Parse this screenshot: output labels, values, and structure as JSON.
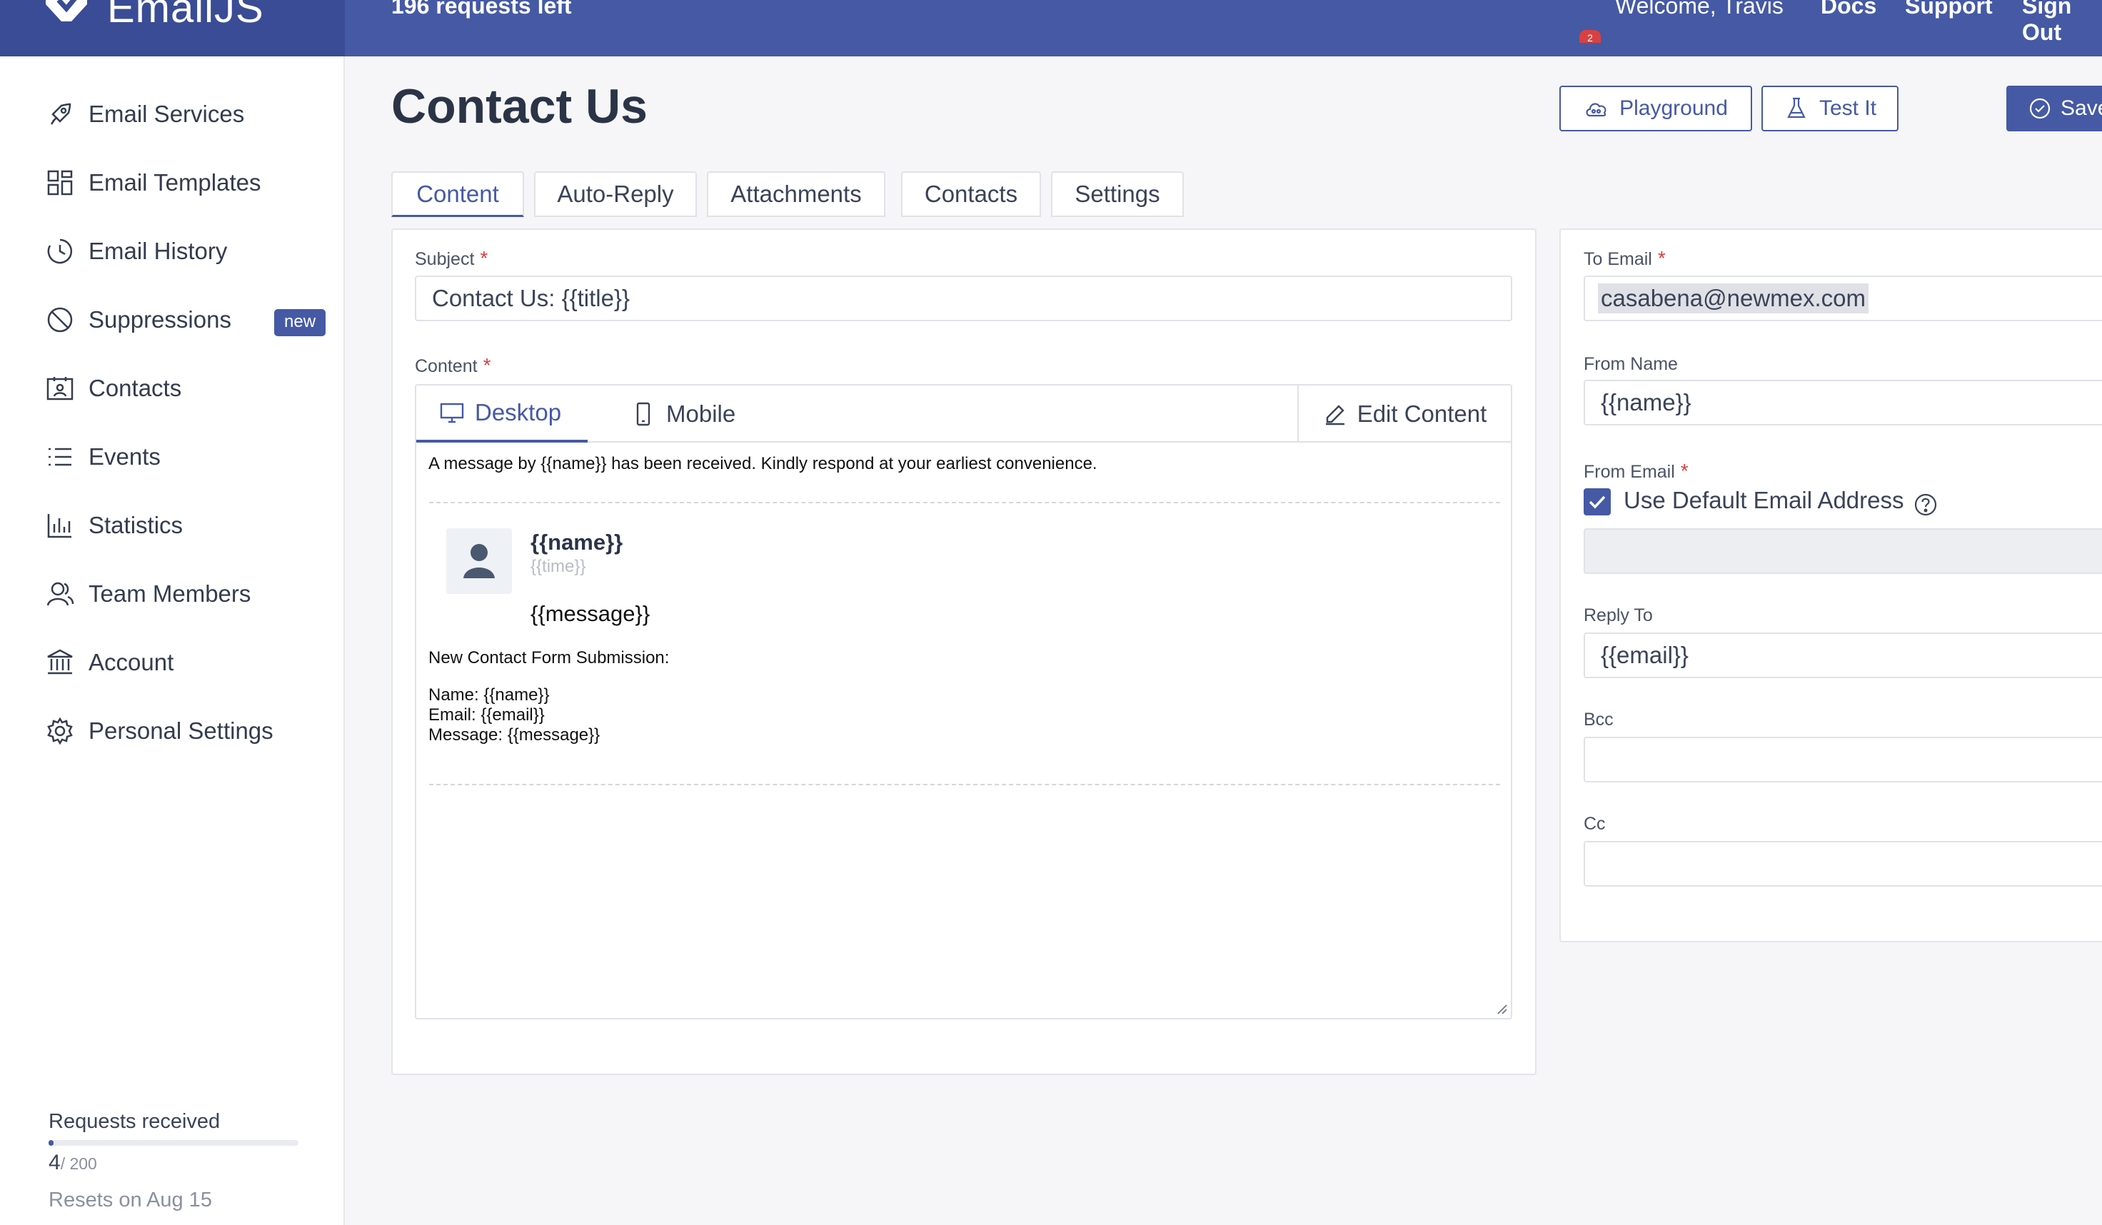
{
  "topbar": {
    "logo_text": "EmailJS",
    "requests_left": "196 requests left",
    "welcome": "Welcome, Travis",
    "notification_count": "2",
    "links": [
      "Docs",
      "Support",
      "Sign Out"
    ]
  },
  "sidebar": {
    "items": [
      {
        "label": "Email Services",
        "icon": "rocket-icon"
      },
      {
        "label": "Email Templates",
        "icon": "grid-icon"
      },
      {
        "label": "Email History",
        "icon": "clock-history-icon"
      },
      {
        "label": "Suppressions",
        "icon": "ban-icon",
        "badge": "new"
      },
      {
        "label": "Contacts",
        "icon": "contact-card-icon"
      },
      {
        "label": "Events",
        "icon": "list-icon"
      },
      {
        "label": "Statistics",
        "icon": "bar-chart-icon"
      },
      {
        "label": "Team Members",
        "icon": "team-icon"
      },
      {
        "label": "Account",
        "icon": "bank-icon"
      },
      {
        "label": "Personal Settings",
        "icon": "gear-icon"
      }
    ],
    "usage": {
      "title": "Requests received",
      "count": "4",
      "total": "/ 200",
      "fraction": 0.02,
      "reset": "Resets on Aug 15"
    }
  },
  "page": {
    "title": "Contact Us",
    "buttons": {
      "playground": "Playground",
      "test_it": "Test It",
      "save": "Save"
    },
    "tabs": [
      "Content",
      "Auto-Reply",
      "Attachments",
      "Contacts",
      "Settings"
    ]
  },
  "content": {
    "subject_label": "Subject",
    "subject_value": "Contact Us: {{title}}",
    "content_label": "Content",
    "editor_tabs": {
      "desktop": "Desktop",
      "mobile": "Mobile",
      "edit": "Edit Content"
    },
    "email_body": {
      "intro": "A message by {{name}} has been received. Kindly respond at your earliest convenience.",
      "card_name": "{{name}}",
      "card_time": "{{time}}",
      "card_message": "{{message}}",
      "submission_title": "New Contact Form Submission:",
      "line_name": "Name: {{name}}",
      "line_email": "Email: {{email}}",
      "line_message": "Message: {{message}}"
    }
  },
  "settings_panel": {
    "to_email_label": "To Email",
    "to_email_value": "casabena@newmex.com",
    "from_name_label": "From Name",
    "from_name_value": "{{name}}",
    "from_email_label": "From Email",
    "use_default_label": "Use Default Email Address",
    "use_default_checked": true,
    "reply_to_label": "Reply To",
    "reply_to_value": "{{email}}",
    "bcc_label": "Bcc",
    "cc_label": "Cc"
  },
  "colors": {
    "brand": "#4559a5",
    "required": "#d94140"
  }
}
